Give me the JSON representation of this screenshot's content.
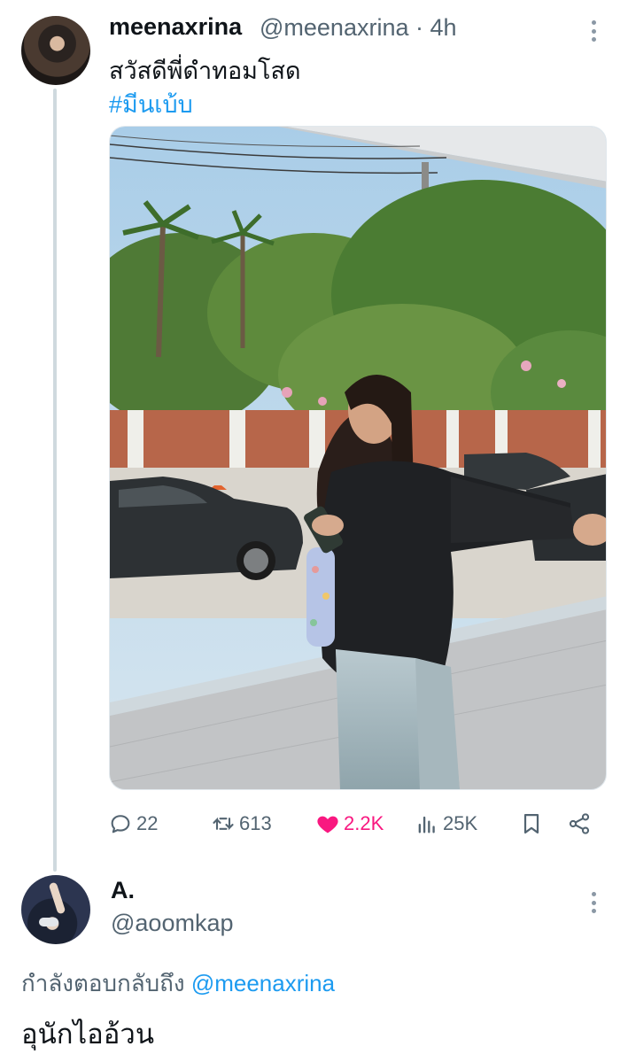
{
  "tweet": {
    "author_name": "meenaxrina",
    "author_handle": "@meenaxrina",
    "time": "· 4h",
    "text": "สวัสดีพี่ดำทอมโสด",
    "hashtag": "#มีนเบ้บ",
    "image_alt": "Photo of a woman in a black shirt and light jeans holding a water bottle and a can, standing under an awning with parked cars and trees behind",
    "actions": {
      "replies": "22",
      "retweets": "613",
      "likes": "2.2K",
      "views": "25K"
    },
    "colors": {
      "like": "#f91880",
      "link": "#1d9bf0",
      "muted": "#536471"
    }
  },
  "reply": {
    "author_name": "A.",
    "author_handle": "@aoomkap",
    "replying_to_prefix": "กำลังตอบกลับถึง",
    "replying_to_handle": "@meenaxrina",
    "text": "อุนักไออ้วน"
  }
}
